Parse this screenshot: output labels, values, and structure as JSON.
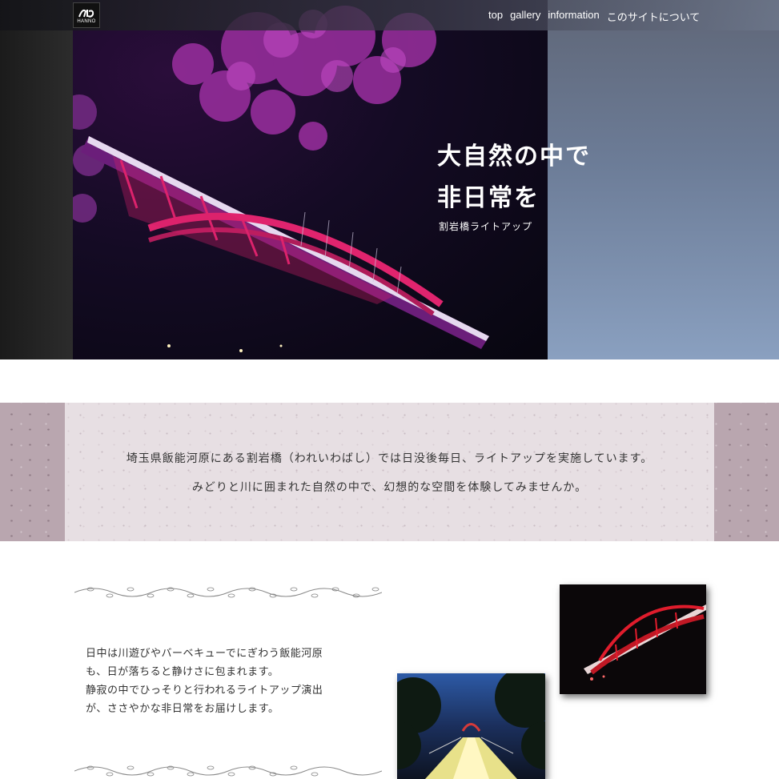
{
  "header": {
    "logo": {
      "text": "HANNO",
      "icon": "hanno-logo-icon"
    },
    "nav": [
      {
        "label": "top"
      },
      {
        "label": "gallery"
      },
      {
        "label": "information"
      },
      {
        "label": "このサイトについて"
      }
    ]
  },
  "hero": {
    "title_line1": "大自然の中で",
    "title_line2": "非日常を",
    "subtitle": "割岩橋ライトアップ",
    "image": "bridge-night-purple-photo"
  },
  "intro": {
    "line1": "埼玉県飯能河原にある割岩橋（われいわばし）では日没後毎日、ライトアップを実施しています。",
    "line2": "みどりと川に囲まれた自然の中で、幻想的な空間を体験してみませんか。"
  },
  "main": {
    "paragraph_lines": [
      "日中は川遊びやバーベキューでにぎわう飯能河原",
      "も、日が落ちると静けさに包まれます。",
      "静寂の中でひっそりと行われるライトアップ演出",
      "が、ささやかな非日常をお届けします。"
    ],
    "photos": [
      "bridge-red-night-photo",
      "bridge-walkway-dusk-photo"
    ],
    "decoration": "vine-divider-icon"
  },
  "colors": {
    "intro_outer": "#b9a6af",
    "intro_panel": "#e7dfe3",
    "bridge_light": "#d91e63",
    "nav_text": "#ffffff"
  }
}
